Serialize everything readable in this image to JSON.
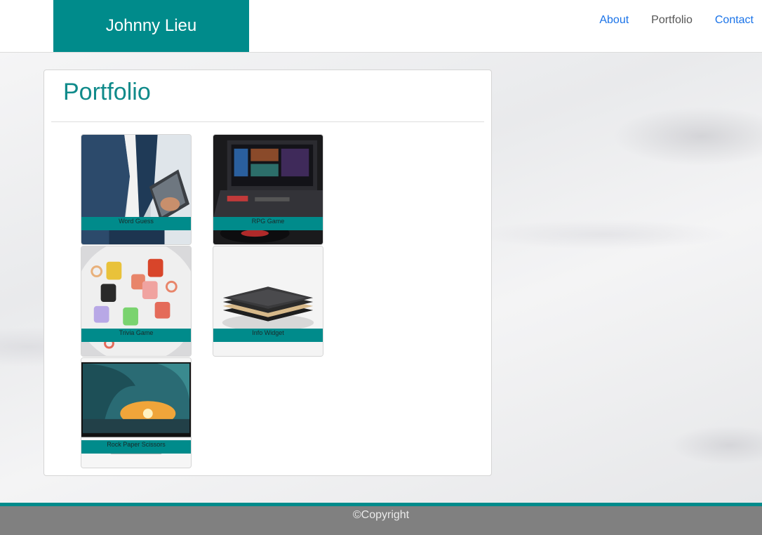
{
  "header": {
    "brand": "Johnny Lieu",
    "nav": [
      {
        "label": "About",
        "active": false
      },
      {
        "label": "Portfolio",
        "active": true
      },
      {
        "label": "Contact",
        "active": false
      }
    ]
  },
  "main": {
    "title": "Portfolio",
    "projects": [
      {
        "label": "Word Guess",
        "image": "business-person-tablet-photo"
      },
      {
        "label": "RPG Game",
        "image": "dj-laptop-controller-photo"
      },
      {
        "label": "Trivia Game",
        "image": "colorful-airpod-cases-photo"
      },
      {
        "label": "Info Widget",
        "image": "wireless-charger-pad-photo"
      },
      {
        "label": "Rock Paper Scissors",
        "image": "wave-sunset-monitor-photo"
      }
    ]
  },
  "footer": {
    "text": "©Copyright"
  },
  "colors": {
    "accent": "#008b8b",
    "link": "#1a73e8",
    "footer_bg": "#808080"
  }
}
